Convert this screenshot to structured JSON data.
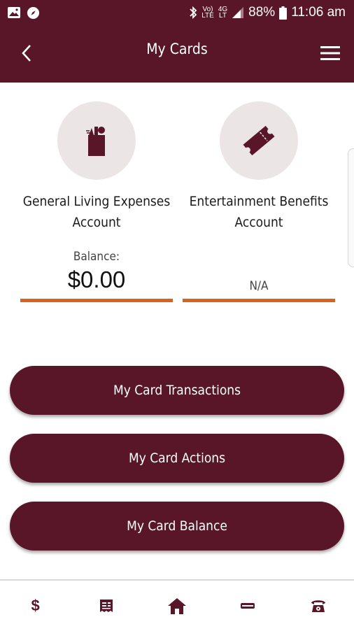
{
  "status_bar": {
    "network_label_top": "Vo)",
    "network_label_bottom": "LTE",
    "data_label_top": "4G",
    "data_label_bottom": "LT",
    "battery": "88%",
    "time": "11:06 am"
  },
  "app_bar": {
    "title": "My Cards"
  },
  "accounts": [
    {
      "name": "General Living Expenses Account",
      "balance_label": "Balance:",
      "balance": "$0.00",
      "icon": "grocery-bag-icon"
    },
    {
      "name": "Entertainment Benefits Account",
      "balance": "N/A",
      "icon": "ticket-icon"
    }
  ],
  "buttons": {
    "transactions": "My Card Transactions",
    "actions": "My Card Actions",
    "balance": "My Card Balance"
  },
  "bottom_nav": {
    "dollar_label": "$",
    "items": [
      "dollar-icon",
      "receipt-icon",
      "home-icon",
      "card-icon",
      "phone-icon"
    ]
  },
  "colors": {
    "brand": "#5a1629",
    "accent": "#d9631c",
    "icon_bg": "#ebe5e6"
  }
}
